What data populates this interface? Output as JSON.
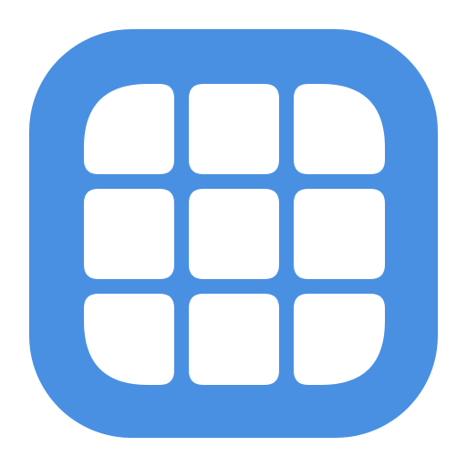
{
  "icon": {
    "name": "grid-app-icon",
    "shape": "rounded-square",
    "background_color": "#4a90e2",
    "tile_color": "#ffffff",
    "grid": {
      "rows": 3,
      "columns": 3,
      "tiles": [
        {
          "row": 1,
          "col": 1,
          "name": "tile-top-left"
        },
        {
          "row": 1,
          "col": 2,
          "name": "tile-top-center"
        },
        {
          "row": 1,
          "col": 3,
          "name": "tile-top-right"
        },
        {
          "row": 2,
          "col": 1,
          "name": "tile-middle-left"
        },
        {
          "row": 2,
          "col": 2,
          "name": "tile-center"
        },
        {
          "row": 2,
          "col": 3,
          "name": "tile-middle-right"
        },
        {
          "row": 3,
          "col": 1,
          "name": "tile-bottom-left"
        },
        {
          "row": 3,
          "col": 2,
          "name": "tile-bottom-center"
        },
        {
          "row": 3,
          "col": 3,
          "name": "tile-bottom-right"
        }
      ]
    }
  }
}
